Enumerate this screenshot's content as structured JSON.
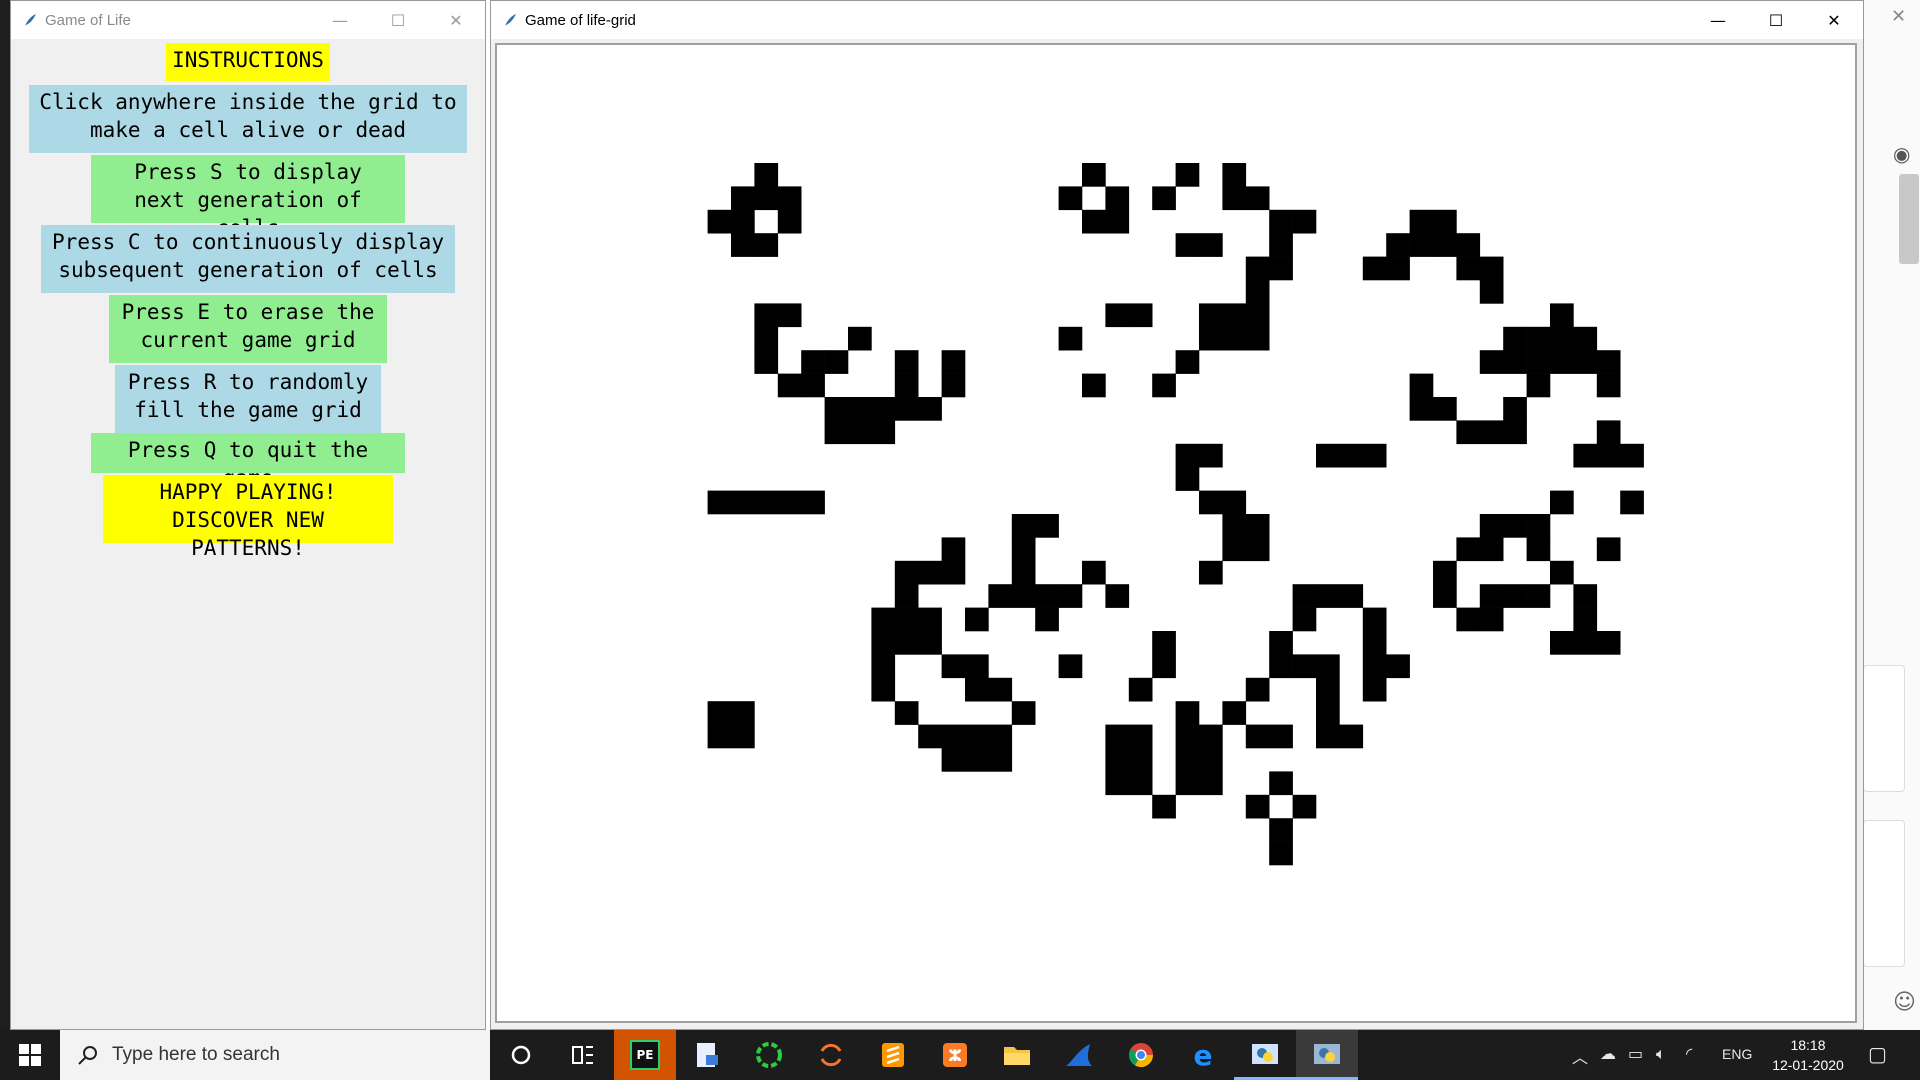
{
  "instructions_window": {
    "title": "Game of Life",
    "items": [
      {
        "text": "INSTRUCTIONS",
        "bg": "#ffff00"
      },
      {
        "text": "Click anywhere inside the grid to\nmake a cell alive or dead",
        "bg": "#add8e6"
      },
      {
        "text": "Press S to display\nnext generation of cells",
        "bg": "#90ee90"
      },
      {
        "text": "Press C to continuously display\nsubsequent generation of cells",
        "bg": "#add8e6"
      },
      {
        "text": "Press E to erase the\ncurrent game grid",
        "bg": "#90ee90"
      },
      {
        "text": "Press R to randomly\nfill the game grid",
        "bg": "#add8e6"
      },
      {
        "text": "Press Q to quit the game",
        "bg": "#90ee90"
      },
      {
        "text": "HAPPY PLAYING!\nDISCOVER NEW PATTERNS!",
        "bg": "#ffff00"
      }
    ]
  },
  "grid_window": {
    "title": "Game of life-grid"
  },
  "grid": {
    "cell_color": "#000000",
    "background": "#ffffff",
    "alive_rows": [
      {
        "row": 5,
        "cols": [
          11,
          25,
          29,
          31
        ]
      },
      {
        "row": 6,
        "cols": [
          10,
          11,
          12,
          24,
          26,
          28,
          31,
          32
        ]
      },
      {
        "row": 7,
        "cols": [
          9,
          10,
          12,
          25,
          26,
          33,
          34,
          39,
          40
        ]
      },
      {
        "row": 8,
        "cols": [
          10,
          11,
          29,
          30,
          33,
          38,
          39,
          40,
          41
        ]
      },
      {
        "row": 9,
        "cols": [
          32,
          33,
          37,
          38,
          41,
          42
        ]
      },
      {
        "row": 10,
        "cols": [
          32,
          42
        ]
      },
      {
        "row": 11,
        "cols": [
          11,
          12,
          26,
          27,
          30,
          31,
          32,
          45
        ]
      },
      {
        "row": 12,
        "cols": [
          11,
          15,
          24,
          30,
          31,
          32,
          43,
          44,
          45,
          46
        ]
      },
      {
        "row": 13,
        "cols": [
          11,
          13,
          14,
          17,
          19,
          29,
          42,
          43,
          44,
          45,
          46,
          47
        ]
      },
      {
        "row": 14,
        "cols": [
          12,
          13,
          17,
          19,
          25,
          28,
          39,
          44,
          47
        ]
      },
      {
        "row": 15,
        "cols": [
          14,
          15,
          16,
          17,
          18,
          39,
          40,
          43
        ]
      },
      {
        "row": 16,
        "cols": [
          14,
          15,
          16,
          41,
          42,
          43,
          47
        ]
      },
      {
        "row": 17,
        "cols": [
          29,
          30,
          35,
          36,
          37,
          46,
          47,
          48
        ]
      },
      {
        "row": 18,
        "cols": [
          29
        ]
      },
      {
        "row": 19,
        "cols": [
          9,
          10,
          11,
          12,
          13,
          30,
          31,
          45,
          48
        ]
      },
      {
        "row": 20,
        "cols": [
          22,
          23,
          31,
          32,
          42,
          43,
          44
        ]
      },
      {
        "row": 21,
        "cols": [
          19,
          22,
          31,
          32,
          41,
          42,
          44,
          47
        ]
      },
      {
        "row": 22,
        "cols": [
          17,
          18,
          19,
          22,
          25,
          30,
          40,
          45
        ]
      },
      {
        "row": 23,
        "cols": [
          17,
          21,
          22,
          23,
          24,
          26,
          34,
          35,
          36,
          40,
          42,
          43,
          44,
          46
        ]
      },
      {
        "row": 24,
        "cols": [
          16,
          17,
          18,
          20,
          23,
          34,
          37,
          41,
          42,
          46
        ]
      },
      {
        "row": 25,
        "cols": [
          16,
          17,
          18,
          28,
          33,
          37,
          45,
          46,
          47
        ]
      },
      {
        "row": 26,
        "cols": [
          16,
          19,
          20,
          24,
          28,
          33,
          34,
          35,
          37,
          38
        ]
      },
      {
        "row": 27,
        "cols": [
          16,
          20,
          21,
          27,
          32,
          35,
          37
        ]
      },
      {
        "row": 28,
        "cols": [
          9,
          10,
          17,
          22,
          29,
          31,
          35
        ]
      },
      {
        "row": 29,
        "cols": [
          9,
          10,
          18,
          19,
          20,
          21,
          26,
          27,
          29,
          30,
          32,
          33,
          35,
          36
        ]
      },
      {
        "row": 30,
        "cols": [
          19,
          20,
          21,
          26,
          27,
          29,
          30
        ]
      },
      {
        "row": 31,
        "cols": [
          26,
          27,
          29,
          30,
          33
        ]
      },
      {
        "row": 32,
        "cols": [
          28,
          32,
          34
        ]
      },
      {
        "row": 33,
        "cols": [
          33
        ]
      },
      {
        "row": 34,
        "cols": [
          33
        ]
      }
    ]
  },
  "taskbar": {
    "search_placeholder": "Type here to search",
    "apps": [
      {
        "icon": "task-view-icon"
      },
      {
        "icon": "pycharm-edu-icon",
        "label": "PE"
      },
      {
        "icon": "document-app-icon"
      },
      {
        "icon": "green-circle-app-icon"
      },
      {
        "icon": "orange-arc-app-icon"
      },
      {
        "icon": "sublime-text-icon"
      },
      {
        "icon": "xampp-icon"
      },
      {
        "icon": "file-explorer-icon"
      },
      {
        "icon": "wireshark-icon"
      },
      {
        "icon": "chrome-icon"
      },
      {
        "icon": "edge-icon"
      },
      {
        "icon": "python-idle-icon"
      },
      {
        "icon": "python-tk-icon"
      }
    ],
    "language": "ENG",
    "time": "18:18",
    "date": "12-01-2020"
  }
}
